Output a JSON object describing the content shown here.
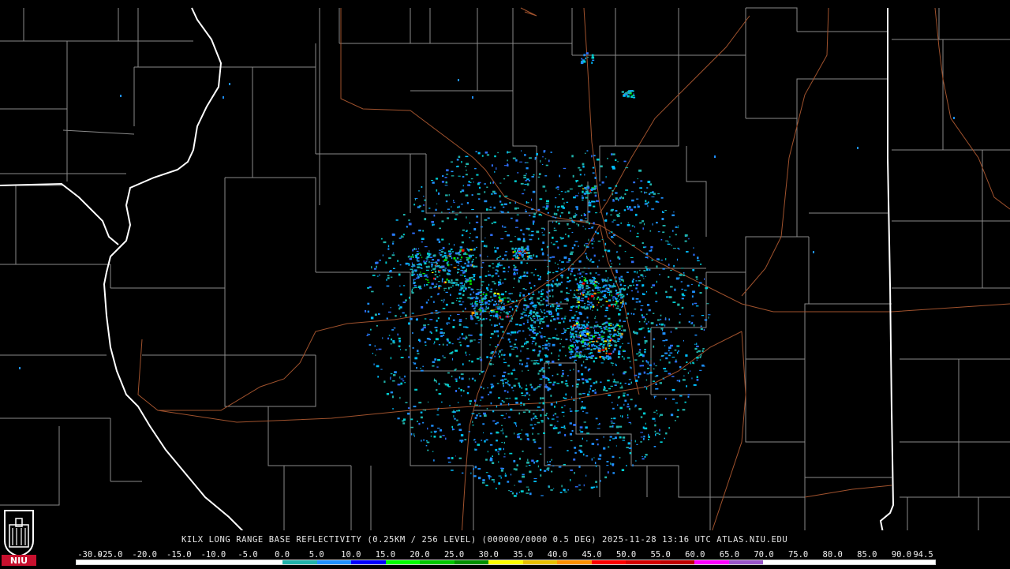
{
  "map": {
    "caption": "KILX LONG RANGE BASE REFLECTIVITY (0.25KM / 256 LEVEL) (000000/0000 0.5 DEG) 2025-11-28 13:16 UTC  ATLAS.NIU.EDU",
    "colors": {
      "background": "#000000",
      "county_lines": "#8a8a8a",
      "state_lines": "#ffffff",
      "highways": "#a0522d"
    }
  },
  "legend": {
    "labels": [
      "-30.0",
      "-25.0",
      "-20.0",
      "-15.0",
      "-10.0",
      "-5.0",
      "0.0",
      "5.0",
      "10.0",
      "15.0",
      "20.0",
      "25.0",
      "30.0",
      "35.0",
      "40.0",
      "45.0",
      "50.0",
      "55.0",
      "60.0",
      "65.0",
      "70.0",
      "75.0",
      "80.0",
      "85.0",
      "90.0",
      "94.5"
    ],
    "colors": [
      "#ffffff",
      "#ffffff",
      "#ffffff",
      "#ffffff",
      "#ffffff",
      "#ffffff",
      "#20b2aa",
      "#1e90ff",
      "#0000ff",
      "#00ff00",
      "#00c800",
      "#009000",
      "#ffff00",
      "#e7c000",
      "#ff9000",
      "#ff0000",
      "#d60000",
      "#c00000",
      "#ff00ff",
      "#9955c9",
      "#ffffff",
      "#ffffff",
      "#ffffff",
      "#ffffff",
      "#ffffff"
    ]
  },
  "logo": {
    "text": "NIU"
  }
}
